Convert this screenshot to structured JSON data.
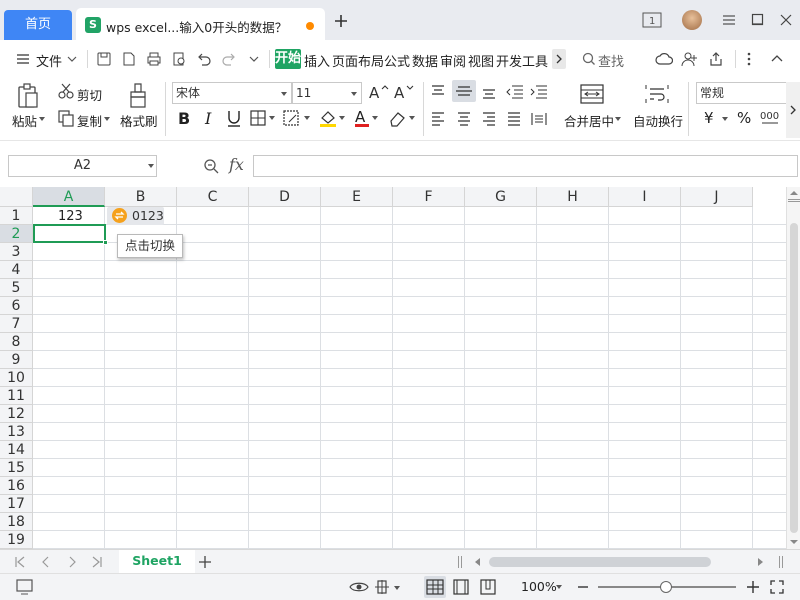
{
  "tabs": {
    "home_label": "首页",
    "doc_title": "wps excel...输入0开头的数据？"
  },
  "menu": {
    "file": "文件",
    "items": [
      "开始",
      "插入",
      "页面布局",
      "公式",
      "数据",
      "审阅",
      "视图",
      "开发工具"
    ],
    "search": "查找"
  },
  "ribbon": {
    "paste": "粘贴",
    "cut": "剪切",
    "copy": "复制",
    "format_painter": "格式刷",
    "font_name": "宋体",
    "font_size": "11",
    "merge_center": "合并居中",
    "wrap_text": "自动换行",
    "number_format": "常规",
    "currency_symbol": "¥",
    "percent_symbol": "%"
  },
  "formula_bar": {
    "name_box": "A2",
    "fx": "fx"
  },
  "grid": {
    "columns": [
      "A",
      "B",
      "C",
      "D",
      "E",
      "F",
      "G",
      "H",
      "I",
      "J"
    ],
    "rows": [
      "1",
      "2",
      "3",
      "4",
      "5",
      "6",
      "7",
      "8",
      "9",
      "10",
      "11",
      "12",
      "13",
      "14",
      "15",
      "16",
      "17",
      "18",
      "19"
    ],
    "cells": {
      "A1": "123",
      "B1": "0123"
    },
    "tooltip": "点击切换"
  },
  "sheets": [
    "Sheet1"
  ],
  "status": {
    "zoom": "100%"
  },
  "colors": {
    "accent_green": "#1fa463",
    "home_tab_blue": "#3f86f5",
    "badge_orange": "#f5a11d"
  }
}
